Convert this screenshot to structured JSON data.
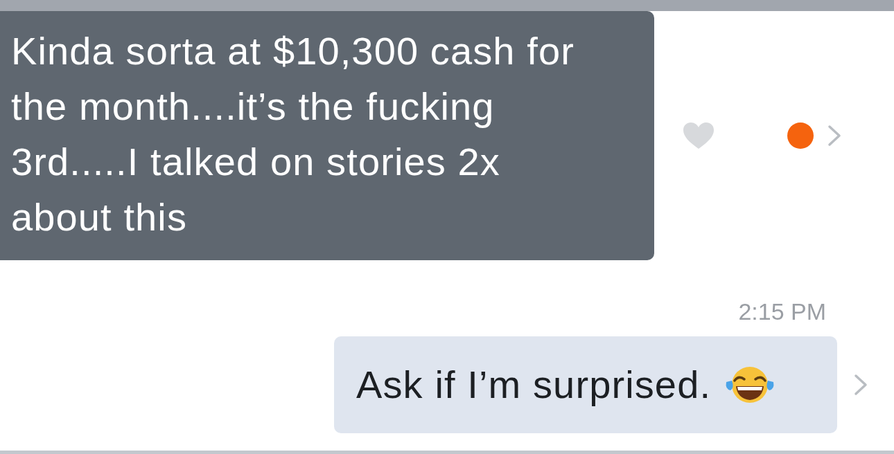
{
  "messages": [
    {
      "kind": "received",
      "text": "Kinda sorta at $10,300 cash for\nthe month....it’s the fucking\n3rd.....I talked on stories 2x\nabout this",
      "unread": true
    },
    {
      "kind": "sent",
      "timestamp": "2:15 PM",
      "text": "Ask if I’m surprised.",
      "emoji": true
    }
  ]
}
